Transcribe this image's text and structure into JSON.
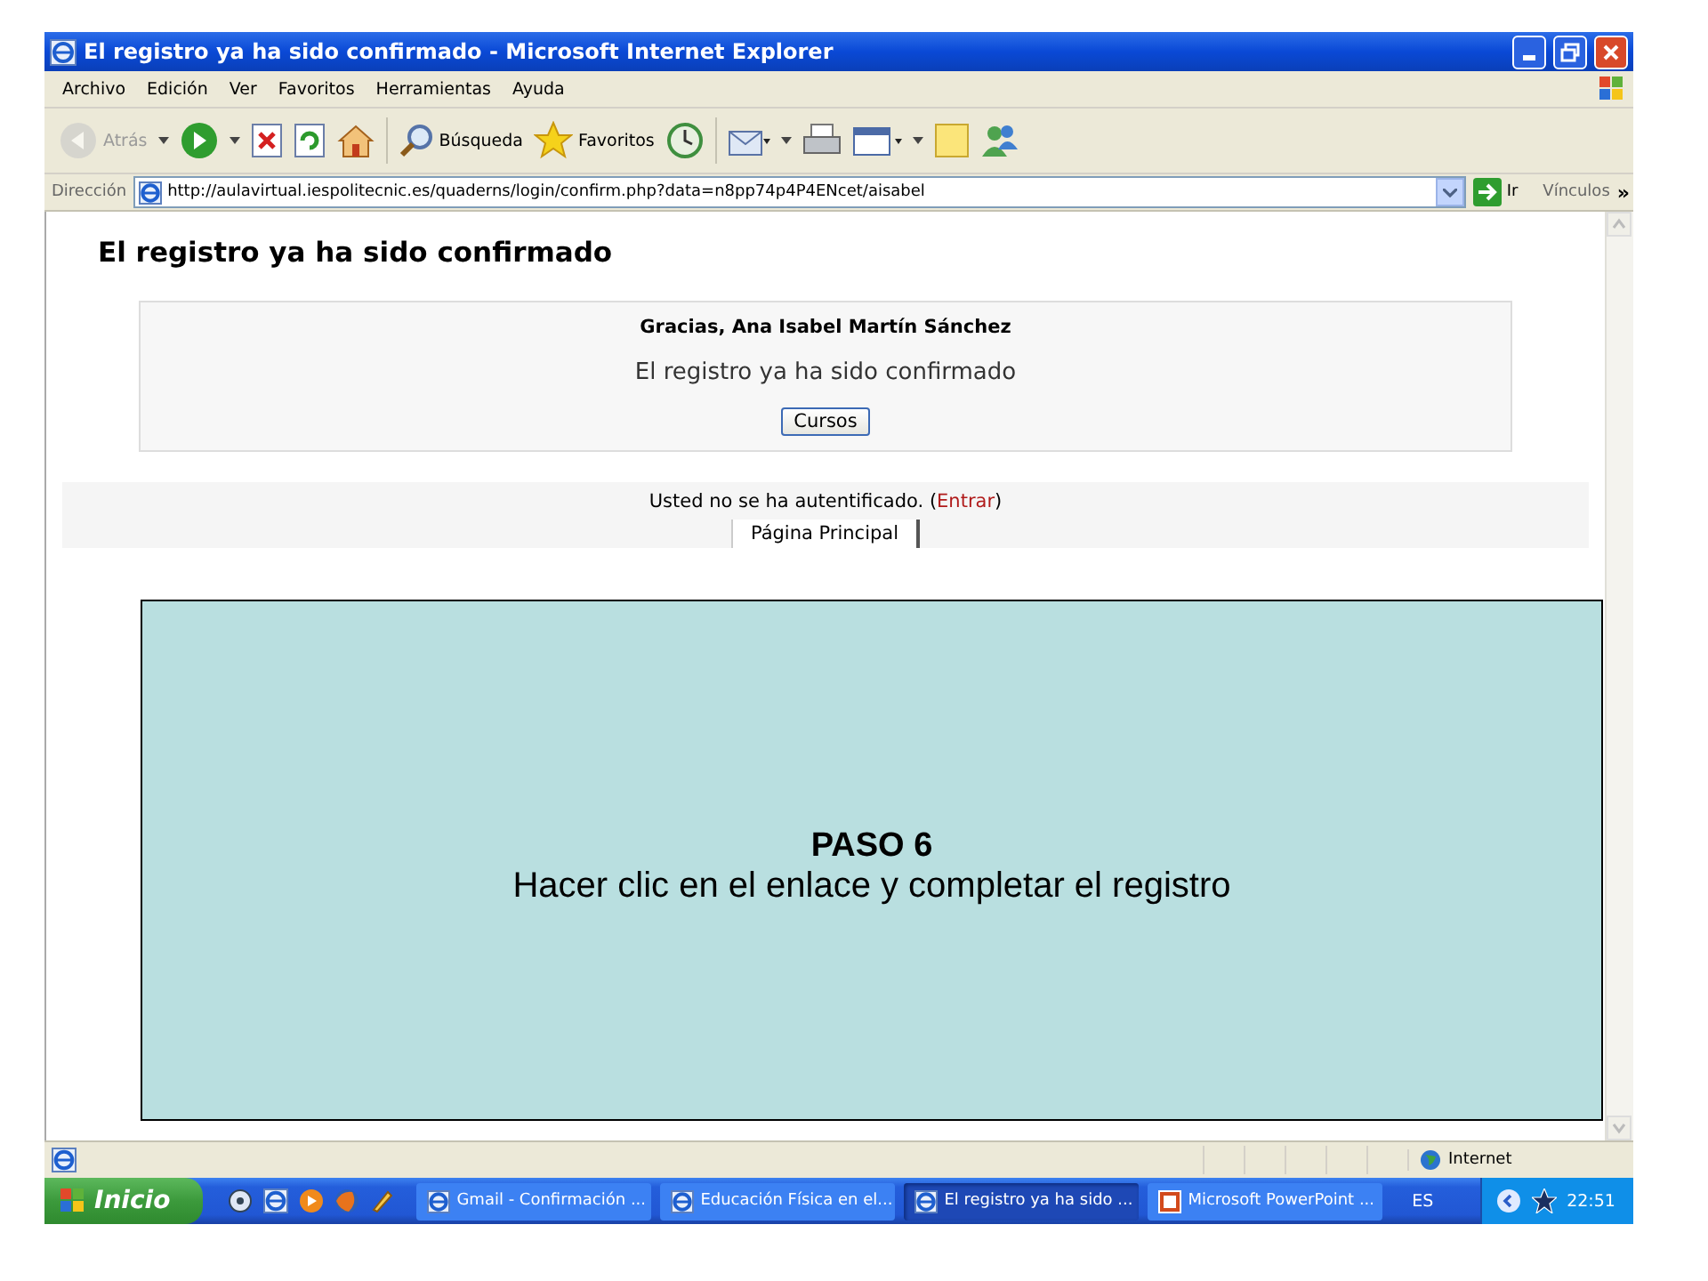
{
  "window": {
    "title": "El registro ya ha sido confirmado - Microsoft Internet Explorer"
  },
  "menu": [
    "Archivo",
    "Edición",
    "Ver",
    "Favoritos",
    "Herramientas",
    "Ayuda"
  ],
  "toolbar": [
    {
      "kind": "back",
      "label": "Atrás",
      "disabled": true
    },
    {
      "kind": "forward",
      "disabled": false
    },
    {
      "kind": "stop",
      "disabled": false
    },
    {
      "kind": "refresh",
      "disabled": false
    },
    {
      "kind": "home",
      "disabled": false
    },
    {
      "kind": "search",
      "label": "Búsqueda",
      "disabled": false
    },
    {
      "kind": "favorites",
      "label": "Favoritos",
      "disabled": false
    },
    {
      "kind": "history",
      "disabled": false
    },
    {
      "kind": "mail",
      "disabled": false
    },
    {
      "kind": "print",
      "disabled": false
    },
    {
      "kind": "edit",
      "disabled": false
    },
    {
      "kind": "note",
      "disabled": false
    },
    {
      "kind": "messenger",
      "disabled": false
    }
  ],
  "address_bar": {
    "label": "Dirección",
    "url": "http://aulavirtual.iespolitecnic.es/quaderns/login/confirm.php?data=n8pp74p4P4ENcet/aisabel",
    "go": "Ir",
    "links": "Vínculos",
    "more": "»"
  },
  "page": {
    "heading": "El registro ya ha sido confirmado",
    "greeting": "Gracias, Ana Isabel Martín Sánchez",
    "message": "El registro ya ha sido confirmado",
    "button": "Cursos",
    "login_notice": {
      "before": "Usted no se ha autentificado. (",
      "link": "Entrar",
      "after": ")"
    },
    "home_tab": "Página Principal"
  },
  "status_bar": {
    "zone": "Internet"
  },
  "taskbar": {
    "start": "Inicio",
    "tasks": [
      {
        "label": "Gmail - Confirmación ...",
        "kind": "ie",
        "selected": false
      },
      {
        "label": "Educación Física en el...",
        "kind": "ie",
        "selected": false
      },
      {
        "label": "El registro ya ha sido ...",
        "kind": "ie",
        "selected": true
      },
      {
        "label": "Microsoft PowerPoint ...",
        "kind": "ppt",
        "selected": false
      }
    ],
    "language": "ES",
    "clock": "22:51"
  },
  "callout": {
    "title": "PASO 6",
    "text": "Hacer clic en el enlace y completar el registro"
  }
}
